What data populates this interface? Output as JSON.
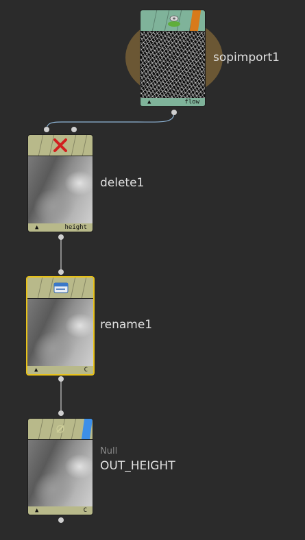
{
  "nodes": {
    "sopimport": {
      "name": "sopimport1",
      "flag": "flow",
      "flag_marker": "▲",
      "accent": "#d87a1a",
      "header_color": "#7fb39a",
      "icon": "sop-import-icon"
    },
    "delete": {
      "name": "delete1",
      "flag": "height",
      "flag_marker": "▲",
      "header_color": "#b8b98a",
      "icon": "delete-x-icon"
    },
    "rename": {
      "name": "rename1",
      "flag": "C",
      "flag_marker": "▲",
      "header_color": "#b8b98a",
      "icon": "rename-tag-icon",
      "selected_outline": "#e8c21a"
    },
    "null": {
      "type": "Null",
      "name": "OUT_HEIGHT",
      "flag": "C",
      "flag_marker": "▲",
      "header_color": "#b8b98a",
      "accent": "#3d8fe8",
      "icon": "null-icon"
    }
  }
}
